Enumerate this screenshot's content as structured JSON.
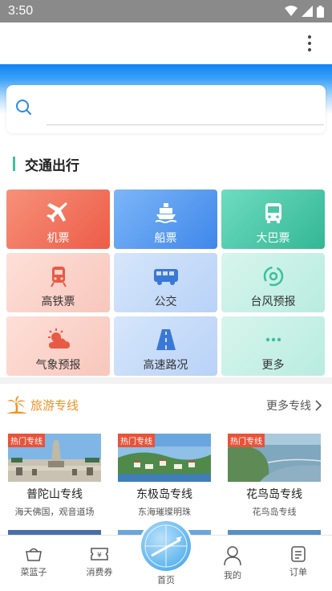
{
  "status_bar": {
    "time": "3:50"
  },
  "search": {
    "placeholder": ""
  },
  "transport": {
    "title": "交通出行",
    "tiles": [
      {
        "label": "机票",
        "icon": "plane-icon"
      },
      {
        "label": "船票",
        "icon": "ship-icon"
      },
      {
        "label": "大巴票",
        "icon": "bus-icon"
      },
      {
        "label": "高铁票",
        "icon": "train-icon"
      },
      {
        "label": "公交",
        "icon": "city-bus-icon"
      },
      {
        "label": "台风预报",
        "icon": "typhoon-icon"
      },
      {
        "label": "气象预报",
        "icon": "weather-icon"
      },
      {
        "label": "高速路况",
        "icon": "highway-icon"
      },
      {
        "label": "更多",
        "icon": "more-dots-icon"
      }
    ]
  },
  "tour": {
    "title": "旅游专线",
    "more_label": "更多专线",
    "cards": [
      {
        "tag": "热门专线",
        "name": "普陀山专线",
        "desc": "海天佛国，观音道场"
      },
      {
        "tag": "热门专线",
        "name": "东极岛专线",
        "desc": "东海璀璨明珠"
      },
      {
        "tag": "热门专线",
        "name": "花鸟岛专线",
        "desc": "花鸟岛专线"
      }
    ]
  },
  "tabs": [
    {
      "label": "菜篮子",
      "icon": "basket-icon"
    },
    {
      "label": "消费券",
      "icon": "coupon-icon"
    },
    {
      "label": "首页",
      "icon": "home-globe-icon"
    },
    {
      "label": "我的",
      "icon": "user-icon"
    },
    {
      "label": "订单",
      "icon": "order-icon"
    }
  ],
  "colors": {
    "accent_blue": "#1e88f0",
    "tour_orange": "#f0902a",
    "hot_tag": "#e8533a",
    "section_bar": "#3cc0a0"
  }
}
